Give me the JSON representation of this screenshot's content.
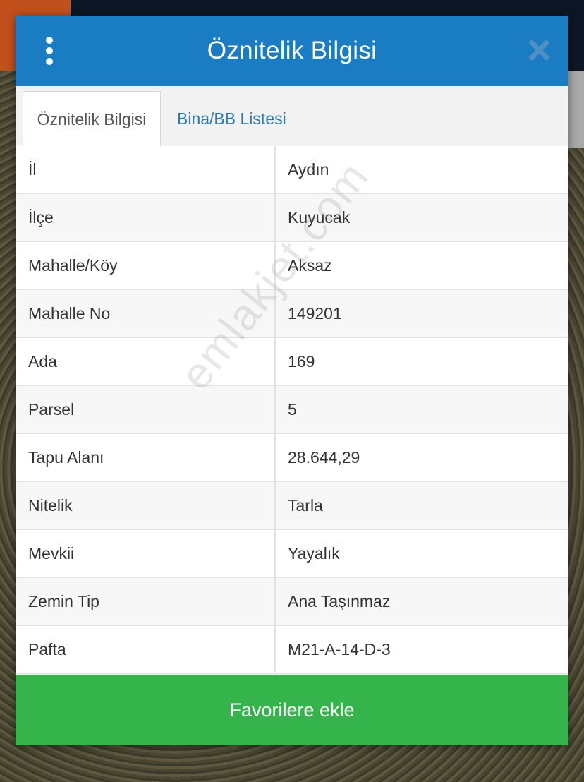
{
  "modal": {
    "title": "Öznitelik Bilgisi",
    "menu_icon": "more-vertical-icon",
    "close_icon": "close-icon"
  },
  "tabs": [
    {
      "label": "Öznitelik Bilgisi",
      "active": true
    },
    {
      "label": "Bina/BB Listesi",
      "active": false
    }
  ],
  "attributes": [
    {
      "key": "İl",
      "value": "Aydın"
    },
    {
      "key": "İlçe",
      "value": "Kuyucak"
    },
    {
      "key": "Mahalle/Köy",
      "value": "Aksaz"
    },
    {
      "key": "Mahalle No",
      "value": "149201"
    },
    {
      "key": "Ada",
      "value": "169"
    },
    {
      "key": "Parsel",
      "value": "5"
    },
    {
      "key": "Tapu Alanı",
      "value": "28.644,29"
    },
    {
      "key": "Nitelik",
      "value": "Tarla"
    },
    {
      "key": "Mevkii",
      "value": "Yayalık"
    },
    {
      "key": "Zemin Tip",
      "value": "Ana Taşınmaz"
    },
    {
      "key": "Pafta",
      "value": "M21-A-14-D-3"
    }
  ],
  "watermark": "emlakjet.com",
  "footer": {
    "button_label": "Favorilere ekle"
  },
  "colors": {
    "header": "#1a7cc3",
    "tab_link": "#2a7ab8",
    "button": "#35b44c"
  }
}
